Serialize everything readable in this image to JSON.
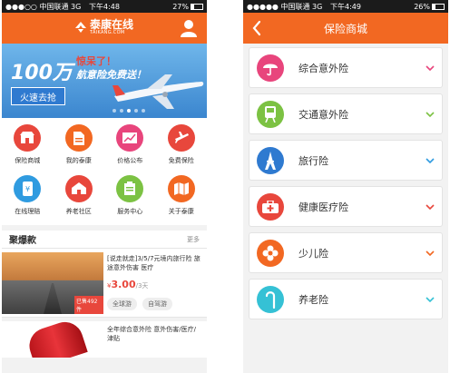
{
  "status_left": {
    "carrier": "●●●○○ 中国联通",
    "network": "3G",
    "time": "下午4:48",
    "battery_pct": "27%",
    "battery_level": 0.27
  },
  "status_right": {
    "carrier": "●●●●● 中国联通",
    "network": "3G",
    "time": "下午4:49",
    "battery_pct": "26%",
    "battery_level": 0.26
  },
  "colors": {
    "brand": "#f26822",
    "red": "#e8473c",
    "blue": "#2f7ad0",
    "green": "#7cc243",
    "cyan": "#35c1d5"
  },
  "header_left": {
    "logo_cn": "泰康在线",
    "logo_en": "TAIKANG.COM",
    "logo_icon": "taikang-logo-icon",
    "user_icon": "user-icon"
  },
  "banner": {
    "big": "100万",
    "line1": "惊呆了！",
    "line2": "航意险免费送！",
    "button": "火速去抢",
    "slides": 5,
    "active_slide": 3
  },
  "grid": [
    {
      "label": "保险商城",
      "icon": "store-icon",
      "color": "#e8473c"
    },
    {
      "label": "我的泰康",
      "icon": "document-icon",
      "color": "#f26822"
    },
    {
      "label": "价格公布",
      "icon": "chart-icon",
      "color": "#e8457c"
    },
    {
      "label": "免费保险",
      "icon": "plane-icon",
      "color": "#e8473c"
    },
    {
      "label": "在线理赔",
      "icon": "phone-yen-icon",
      "color": "#2f9be0"
    },
    {
      "label": "养老社区",
      "icon": "house-icon",
      "color": "#e8473c"
    },
    {
      "label": "服务中心",
      "icon": "clipboard-icon",
      "color": "#7cc243"
    },
    {
      "label": "关于泰康",
      "icon": "map-icon",
      "color": "#f26822"
    }
  ],
  "hot": {
    "title": "聚爆款",
    "more": "更多"
  },
  "products": [
    {
      "desc": "[说走就走]3/5/7元境内旅行险 旅途意外伤害 医疗",
      "currency": "¥",
      "price": "3.00",
      "unit": "/3天",
      "sold": "已售492件",
      "tags": [
        "全球游",
        "自驾游"
      ]
    },
    {
      "desc": "全年综合意外险 意外伤害/医疗/津贴"
    }
  ],
  "right": {
    "title": "保险商城",
    "back_icon": "back-arrow-icon",
    "items": [
      {
        "label": "综合意外险",
        "icon": "umbrella-icon",
        "color": "#e8457c",
        "chev": "#e8457c"
      },
      {
        "label": "交通意外险",
        "icon": "train-icon",
        "color": "#7cc243",
        "chev": "#7cc243"
      },
      {
        "label": "旅行险",
        "icon": "tower-icon",
        "color": "#2f7ad0",
        "chev": "#2f9be0"
      },
      {
        "label": "健康医疗险",
        "icon": "medkit-icon",
        "color": "#e8473c",
        "chev": "#e8473c"
      },
      {
        "label": "少儿险",
        "icon": "flower-icon",
        "color": "#f26822",
        "chev": "#f26822"
      },
      {
        "label": "养老险",
        "icon": "cane-icon",
        "color": "#35c1d5",
        "chev": "#35c1d5"
      }
    ]
  }
}
